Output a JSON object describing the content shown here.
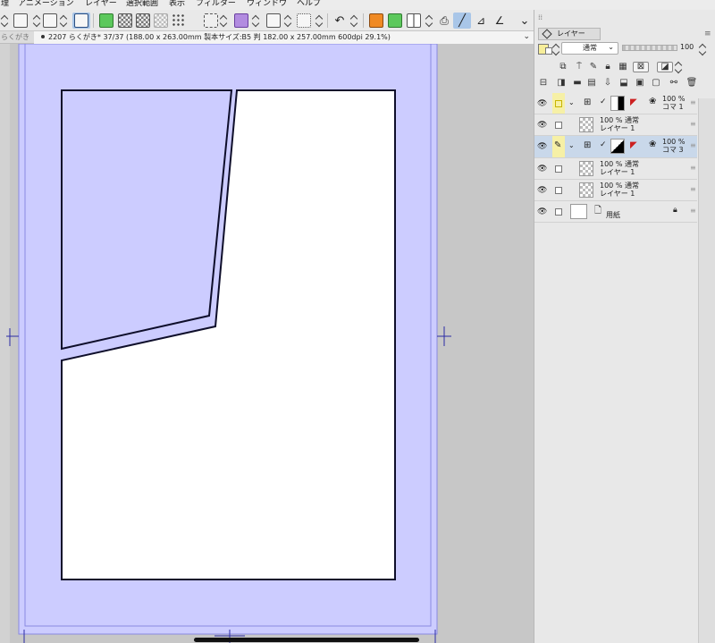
{
  "menu": [
    "理",
    "アニメーション",
    "レイヤー",
    "選択範囲",
    "表示",
    "フィルター",
    "ウィンドウ",
    "ヘルプ"
  ],
  "toolbar": {
    "icons": [
      "stepper-icon",
      "fit-icon",
      "stepper-icon",
      "rotate-fit-icon",
      "paste-layer-icon",
      "select-all-icon",
      "select-invert-icon",
      "deselect-icon",
      "grid-dots-icon",
      "marquee-icon",
      "crop-icon",
      "transform-icon",
      "undo-icon",
      "redo-icon",
      "layer-orange-icon",
      "layer-green-icon",
      "table-icon",
      "pen-snap-icon",
      "ruler-icon",
      "ruler2-icon",
      "expand-icon"
    ],
    "accent_green": "#5cc85c",
    "accent_orange": "#f08a24",
    "accent_purple": "#b28ce0",
    "accent_selected": "#a9c6e8"
  },
  "tabs": {
    "previous": "らくがき",
    "active": "2207 らくがき* 37/37 (188.00 x 263.00mm 製本サイズ:B5 判 182.00 x 257.00mm 600dpi 29.1%)"
  },
  "canvas": {
    "page_color": "#ccccff",
    "panel_fill": "#ffffff",
    "frame_border": "#0e0e2a",
    "guide_color": "#2b2ba6"
  },
  "layer_panel": {
    "tab_label": "レイヤー",
    "blend_mode": "通常",
    "opacity": "100",
    "main_color": "#f7ee9a",
    "sub_color": "#ffffff",
    "layers": [
      {
        "percent": "100 %",
        "name": "コマ 1",
        "kind": "frame-folder",
        "selected": false,
        "yellow": true
      },
      {
        "percent": "100 % 通常",
        "name": "レイヤー 1",
        "kind": "raster",
        "selected": false,
        "yellow": false
      },
      {
        "percent": "100 %",
        "name": "コマ 3",
        "kind": "frame-folder",
        "selected": true,
        "yellow": true
      },
      {
        "percent": "100 % 通常",
        "name": "レイヤー 1",
        "kind": "raster",
        "selected": false,
        "yellow": false
      },
      {
        "percent": "100 % 通常",
        "name": "レイヤー 1",
        "kind": "raster",
        "selected": false,
        "yellow": false
      },
      {
        "percent": "",
        "name": "用紙",
        "kind": "paper",
        "selected": false,
        "yellow": false
      }
    ]
  }
}
